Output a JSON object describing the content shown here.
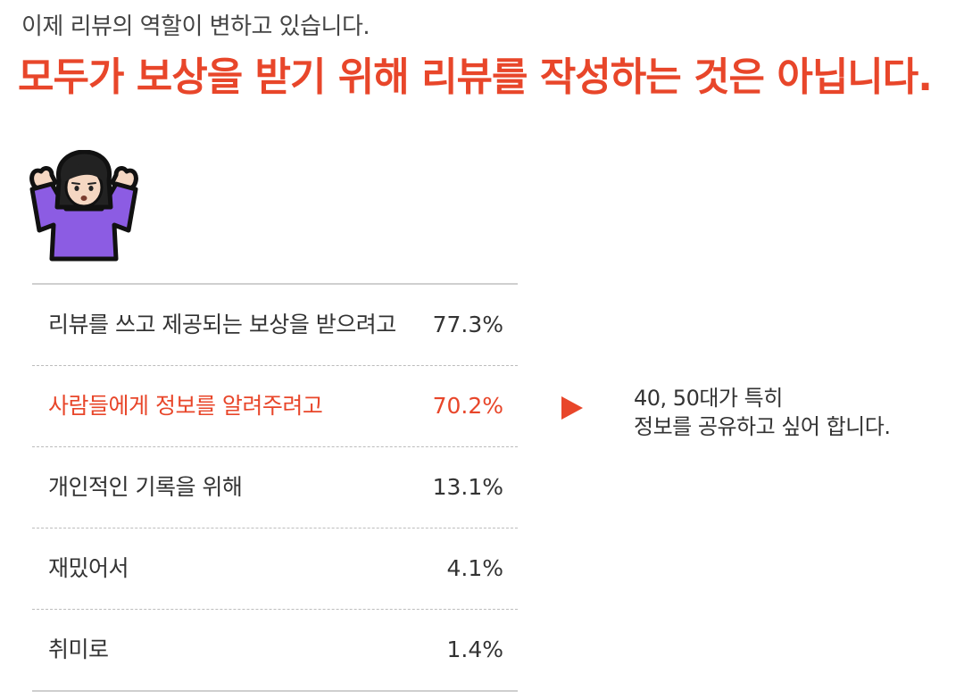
{
  "header": {
    "subtitle": "이제 리뷰의 역할이 변하고 있습니다.",
    "headline": "모두가 보상을 받기 위해 리뷰를 작성하는 것은 아닙니다."
  },
  "colors": {
    "accent": "#e8462a",
    "text": "#333333",
    "divider": "#cfcfcf"
  },
  "illustration": {
    "icon": "person-shrugging-emoji"
  },
  "stats": {
    "rows": [
      {
        "label": "리뷰를 쓰고 제공되는 보상을 받으려고",
        "value": "77.3%",
        "highlight": false
      },
      {
        "label": "사람들에게 정보를 알려주려고",
        "value": "70.2%",
        "highlight": true
      },
      {
        "label": "개인적인 기록을 위해",
        "value": "13.1%",
        "highlight": false
      },
      {
        "label": "재밌어서",
        "value": "4.1%",
        "highlight": false
      },
      {
        "label": "취미로",
        "value": "1.4%",
        "highlight": false
      }
    ]
  },
  "note": {
    "line1": "40, 50대가 특히",
    "line2": "정보를 공유하고 싶어 합니다."
  }
}
